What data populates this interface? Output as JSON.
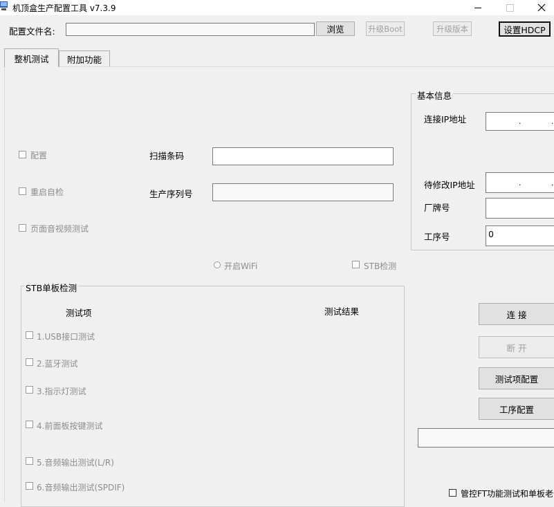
{
  "window": {
    "title": "机顶盒生产配置工具 v7.3.9"
  },
  "header": {
    "config_file_label": "配置文件名:",
    "config_file_value": "",
    "browse_label": "浏览",
    "upgrade_boot_label": "升级Boot",
    "upgrade_version_label": "升级版本",
    "set_hdcp_label": "设置HDCP"
  },
  "tabs": [
    {
      "label": "整机测试",
      "active": true
    },
    {
      "label": "附加功能",
      "active": false
    }
  ],
  "main": {
    "config_checkbox": "配置",
    "restart_checkbox": "重启自检",
    "av_checkbox": "页面音视频测试",
    "scan_barcode_label": "扫描条码",
    "scan_barcode_value": "",
    "serial_label": "生产序列号",
    "serial_value": "",
    "wifi_radio": "开启WiFi",
    "stb_check": "STB检测"
  },
  "stb_board": {
    "legend": "STB单板检测",
    "col_item": "测试项",
    "col_result": "测试结果",
    "items": [
      "1.USB接口测试",
      "2.蓝牙测试",
      "3.指示灯测试",
      "4.前面板按键测试",
      "5.音频输出测试(L/R)",
      "6.音频输出测试(SPDIF)"
    ]
  },
  "basic_info": {
    "legend": "基本信息",
    "connect_ip_label": "连接IP地址",
    "modify_ip_label": "待修改IP地址",
    "vendor_label": "厂牌号",
    "process_label": "工序号",
    "process_value": "0"
  },
  "actions": {
    "connect_label": "连 接",
    "disconnect_label": "断 开",
    "test_config_label": "测试项配置",
    "process_config_label": "工序配置",
    "ft_checkbox": "管控FT功能测试和单板老化"
  }
}
